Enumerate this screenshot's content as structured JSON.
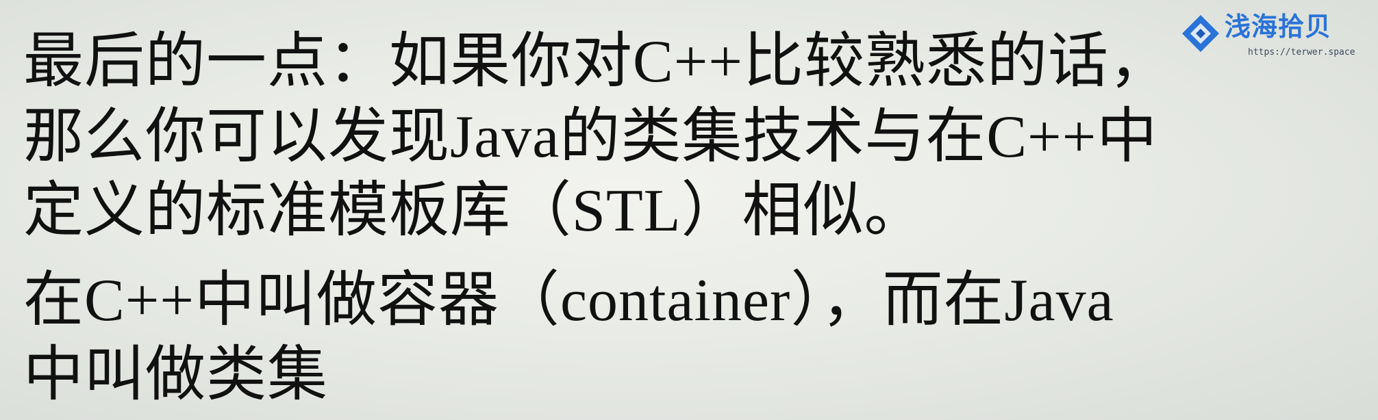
{
  "slide": {
    "lines": [
      "最后的一点：如果你对C++比较熟悉的话，",
      "那么你可以发现Java的类集技术与在C++中",
      "定义的标准模板库（STL）相似。",
      "在C++中叫做容器（container），而在Java",
      "中叫做类集"
    ]
  },
  "watermark": {
    "brand": "浅海拾贝",
    "url": "https://terwer.space",
    "logo_icon": "diamond-logo-icon",
    "brand_color": "#2a73d8"
  }
}
